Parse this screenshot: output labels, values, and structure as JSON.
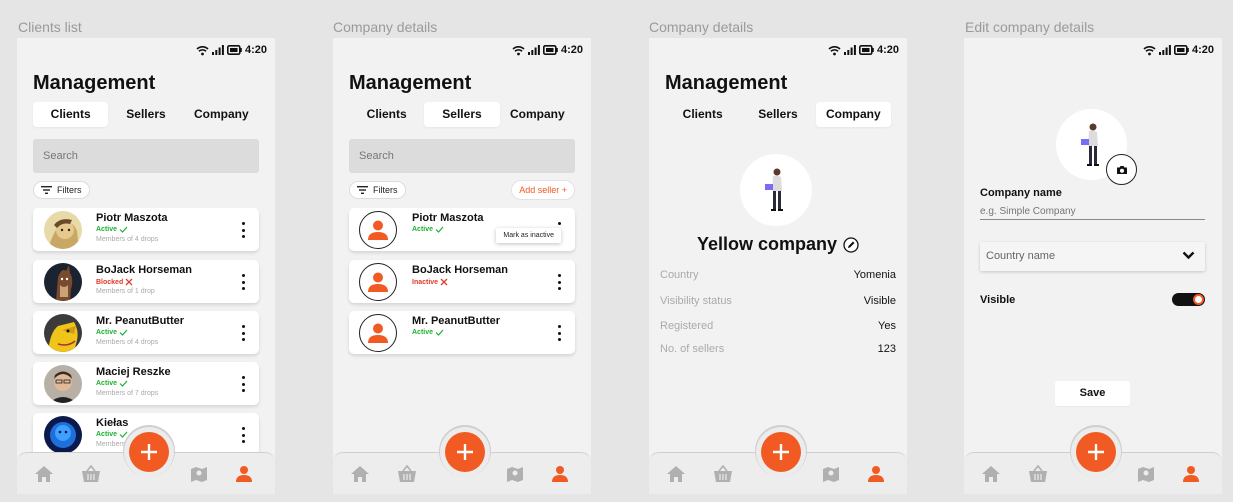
{
  "screens": [
    {
      "title": "Clients list"
    },
    {
      "title": "Company details"
    },
    {
      "title": "Company details"
    },
    {
      "title": "Edit company details"
    }
  ],
  "status": {
    "time": "4:20"
  },
  "header": {
    "title": "Management"
  },
  "tabs": {
    "clients": "Clients",
    "sellers": "Sellers",
    "company": "Company"
  },
  "search": {
    "placeholder": "Search"
  },
  "filters": {
    "label": "Filters"
  },
  "add_seller": {
    "label": "Add seller +"
  },
  "clients": [
    {
      "name": "Piotr Maszota",
      "status": "Active",
      "meta": "Members of 4 drops"
    },
    {
      "name": "BoJack Horseman",
      "status": "Blocked",
      "meta": "Members of 1 drop"
    },
    {
      "name": "Mr. PeanutButter",
      "status": "Active",
      "meta": "Members of 4 drops"
    },
    {
      "name": "Maciej Reszke",
      "status": "Active",
      "meta": "Members of 7 drops"
    },
    {
      "name": "Kiełas",
      "status": "Active",
      "meta": "Members"
    }
  ],
  "sellers": [
    {
      "name": "Piotr Maszota",
      "status": "Active"
    },
    {
      "name": "BoJack Horseman",
      "status": "Inactive"
    },
    {
      "name": "Mr. PeanutButter",
      "status": "Active"
    }
  ],
  "menu": {
    "mark_inactive": "Mark as inactive"
  },
  "company": {
    "name": "Yellow company",
    "rows": [
      {
        "key": "Country",
        "value": "Yomenia"
      },
      {
        "key": "Visibility status",
        "value": "Visible"
      },
      {
        "key": "Registered",
        "value": "Yes"
      },
      {
        "key": "No. of sellers",
        "value": "123"
      }
    ]
  },
  "edit": {
    "name_label": "Company name",
    "name_placeholder": "e.g. Simple Company",
    "country_placeholder": "Country name",
    "visible_label": "Visible",
    "visible": true,
    "save_label": "Save"
  },
  "colors": {
    "accent": "#f15a22",
    "active": "#1db232",
    "blocked": "#e23a2a"
  }
}
